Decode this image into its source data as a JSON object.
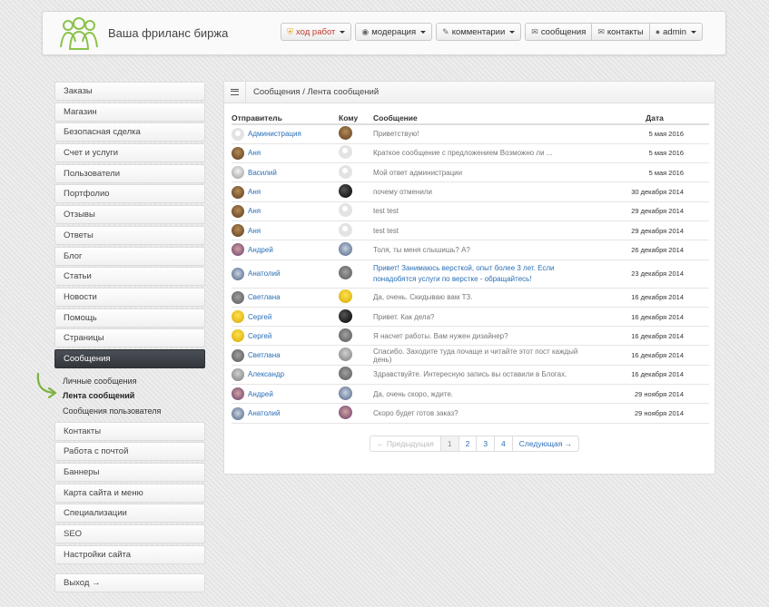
{
  "header": {
    "site_title": "Ваша фриланс биржа",
    "nav": [
      {
        "label": "ход работ",
        "icon": "shield-icon",
        "dropdown": true,
        "warn": true
      },
      {
        "label": "модерация",
        "icon": "eye-icon",
        "dropdown": true
      },
      {
        "label": "комментарии",
        "icon": "pencil-icon",
        "dropdown": true
      },
      {
        "label": "сообщения",
        "icon": "envelope-icon",
        "dropdown": false
      },
      {
        "label": "контакты",
        "icon": "envelope-icon",
        "dropdown": false
      },
      {
        "label": "admin",
        "icon": "user-icon",
        "dropdown": true
      }
    ]
  },
  "sidebar": {
    "items_top": [
      "Заказы",
      "Магазин",
      "Безопасная сделка",
      "Счет и услуги",
      "Пользователи",
      "Портфолио",
      "Отзывы",
      "Ответы",
      "Блог",
      "Статьи",
      "Новости",
      "Помощь",
      "Страницы"
    ],
    "active": "Сообщения",
    "subitems": [
      "Личные сообщения",
      "Лента сообщений",
      "Сообщения пользователя"
    ],
    "items_bottom": [
      "Контакты",
      "Работа с почтой",
      "Баннеры",
      "Карта сайта и меню",
      "Специализации",
      "SEO",
      "Настройки сайта"
    ],
    "logout": "Выход →"
  },
  "panel": {
    "breadcrumb": "Сообщения / Лента сообщений",
    "columns": {
      "sender": "Отправитель",
      "to": "Кому",
      "message": "Сообщение",
      "date": "Дата"
    },
    "rows": [
      {
        "sender": "Администрация",
        "sender_av": "ghost",
        "to_av": "brown",
        "message": "Приветствую!",
        "date": "5 мая 2016",
        "unread": false
      },
      {
        "sender": "Аня",
        "sender_av": "brown",
        "to_av": "ghost",
        "message": "Краткое сообщение с предложением Возможно ли ...",
        "date": "5 мая 2016",
        "unread": false
      },
      {
        "sender": "Василий",
        "sender_av": "light",
        "to_av": "ghost",
        "message": "Мой ответ администрации",
        "date": "5 мая 2016",
        "unread": false
      },
      {
        "sender": "Аня",
        "sender_av": "brown",
        "to_av": "black",
        "message": "почему отменили",
        "date": "30 декабря 2014",
        "unread": false
      },
      {
        "sender": "Аня",
        "sender_av": "brown",
        "to_av": "ghost",
        "message": "test test",
        "date": "29 декабря 2014",
        "unread": false
      },
      {
        "sender": "Аня",
        "sender_av": "brown",
        "to_av": "ghost",
        "message": "test test",
        "date": "29 декабря 2014",
        "unread": false
      },
      {
        "sender": "Андрей",
        "sender_av": "purple",
        "to_av": "blue",
        "message": "Толя, ты меня слышишь? А?",
        "date": "26 декабря 2014",
        "unread": false
      },
      {
        "sender": "Анатолий",
        "sender_av": "blue",
        "to_av": "gray",
        "message": "Привет! Занимаюсь версткой, опыт более 3 лет. Если понадобятся услуги по верстке - обращайтесь!",
        "date": "23 декабря 2014",
        "unread": true
      },
      {
        "sender": "Светлана",
        "sender_av": "gray",
        "to_av": "yellow",
        "message": "Да, очень. Скидываю вам ТЗ.",
        "date": "16 декабря 2014",
        "unread": false
      },
      {
        "sender": "Сергей",
        "sender_av": "yellow",
        "to_av": "black",
        "message": "Привет. Как дела?",
        "date": "16 декабря 2014",
        "unread": false
      },
      {
        "sender": "Сергей",
        "sender_av": "yellow",
        "to_av": "gray",
        "message": "Я насчет работы. Вам нужен дизайнер?",
        "date": "16 декабря 2014",
        "unread": false
      },
      {
        "sender": "Светлана",
        "sender_av": "gray",
        "to_av": "grayw",
        "message": "Спасибо. Заходите туда почаще и читайте этот пост каждый день)",
        "date": "16 декабря 2014",
        "unread": false
      },
      {
        "sender": "Александр",
        "sender_av": "grayw",
        "to_av": "gray",
        "message": "Здравствуйте. Интересную запись вы оставили в Блогах.",
        "date": "16 декабря 2014",
        "unread": false
      },
      {
        "sender": "Андрей",
        "sender_av": "purple",
        "to_av": "blue",
        "message": "Да, очень скоро, ждите.",
        "date": "29 ноября 2014",
        "unread": false
      },
      {
        "sender": "Анатолий",
        "sender_av": "blue",
        "to_av": "purple",
        "message": "Скоро будет готов заказ?",
        "date": "29 ноября 2014",
        "unread": false
      }
    ],
    "pagination": {
      "prev": "← Предыдущая",
      "pages": [
        "1",
        "2",
        "3",
        "4"
      ],
      "current": "1",
      "next": "Следующая →"
    }
  },
  "colors": {
    "link": "#2a6fb5",
    "active_sidebar": "#3a3e44",
    "arrow": "#7cb342",
    "logo": "#8bc34a"
  }
}
